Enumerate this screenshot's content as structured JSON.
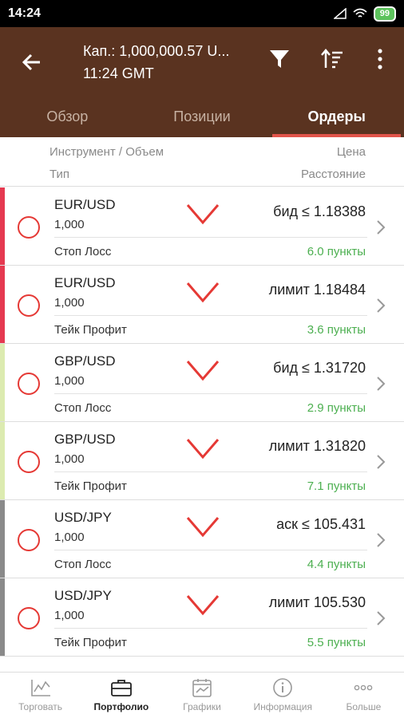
{
  "status": {
    "time": "14:24",
    "battery": "99"
  },
  "header": {
    "capital": "Кап.: 1,000,000.57 U...",
    "time": "11:24 GMT",
    "icons": [
      "arrow-left-icon",
      "filter-icon",
      "sort-icon",
      "more-vert-icon"
    ]
  },
  "tabs": [
    {
      "label": "Обзор",
      "active": false
    },
    {
      "label": "Позиции",
      "active": false
    },
    {
      "label": "Ордеры",
      "active": true
    }
  ],
  "columns": {
    "instrument_volume": "Инструмент / Объем",
    "type": "Тип",
    "price": "Цена",
    "distance": "Расстояние"
  },
  "orders": [
    {
      "instrument": "EUR/USD",
      "volume": "1,000",
      "type": "Стоп Лосс",
      "price": "бид ≤ 1.18388",
      "distance": "6.0  пункты",
      "stripe": "#e53950"
    },
    {
      "instrument": "EUR/USD",
      "volume": "1,000",
      "type": "Тейк Профит",
      "price": "лимит 1.18484",
      "distance": "3.6  пункты",
      "stripe": "#e53950"
    },
    {
      "instrument": "GBP/USD",
      "volume": "1,000",
      "type": "Стоп Лосс",
      "price": "бид ≤ 1.31720",
      "distance": "2.9  пункты",
      "stripe": "#dcebb0"
    },
    {
      "instrument": "GBP/USD",
      "volume": "1,000",
      "type": "Тейк Профит",
      "price": "лимит 1.31820",
      "distance": "7.1  пункты",
      "stripe": "#dcebb0"
    },
    {
      "instrument": "USD/JPY",
      "volume": "1,000",
      "type": "Стоп Лосс",
      "price": "аск ≤ 105.431",
      "distance": "4.4  пункты",
      "stripe": "#8a8a8a"
    },
    {
      "instrument": "USD/JPY",
      "volume": "1,000",
      "type": "Тейк Профит",
      "price": "лимит 105.530",
      "distance": "5.5  пункты",
      "stripe": "#8a8a8a"
    }
  ],
  "nav": [
    {
      "label": "Торговать",
      "icon": "chart-icon",
      "active": false
    },
    {
      "label": "Портфолио",
      "icon": "briefcase-icon",
      "active": true
    },
    {
      "label": "Графики",
      "icon": "calendar-chart-icon",
      "active": false
    },
    {
      "label": "Информация",
      "icon": "info-icon",
      "active": false
    },
    {
      "label": "Больше",
      "icon": "more-horiz-icon",
      "active": false
    }
  ],
  "colors": {
    "appbar": "#5a3320",
    "accent": "#e0544a",
    "sell": "#e53935",
    "distance": "#4caf50"
  }
}
